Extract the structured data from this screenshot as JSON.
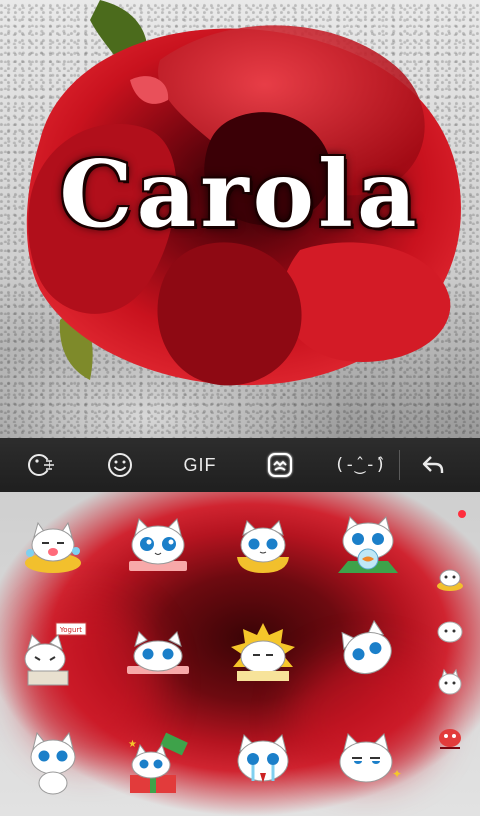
{
  "hero": {
    "title": "Carola"
  },
  "toolbar": {
    "gif_label": "GIF",
    "kaomoji_label": "(-̂‿-̂)",
    "items": [
      "emoji-search-icon",
      "smiley-icon",
      "gif",
      "sticker-icon",
      "kaomoji",
      "back-arrow-icon"
    ]
  },
  "stickers": {
    "yogurt_label": "Yogurt",
    "rows": [
      [
        "cat-bathtub",
        "cat-blue-eyes",
        "cat-bowl",
        "cat-fishbowl"
      ],
      [
        "cat-yogurt",
        "cat-peek",
        "cat-sunshine",
        "cat-tilted"
      ],
      [
        "cat-sitting",
        "cat-giftbox",
        "cat-crying",
        "cat-sly"
      ]
    ]
  },
  "sidebar": {
    "items": [
      "cat-bath-small",
      "cat-white-small",
      "cat-ghost-small",
      "cat-red-small"
    ]
  },
  "colors": {
    "accent_red": "#c8141f",
    "toolbar_bg": "#252525",
    "notification_dot": "#ff2e3d"
  }
}
